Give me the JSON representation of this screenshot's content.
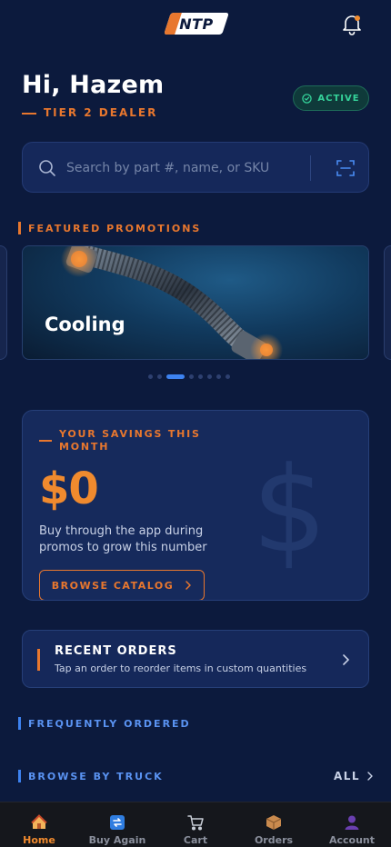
{
  "header": {
    "logo_text": "NTP",
    "has_notification": true
  },
  "greeting": {
    "title": "Hi, Hazem",
    "tier": "TIER 2 DEALER",
    "status_badge": "ACTIVE"
  },
  "search": {
    "placeholder": "Search by part #, name, or SKU",
    "value": ""
  },
  "promotions": {
    "section_title": "FEATURED PROMOTIONS",
    "current_title": "Cooling",
    "slide_count": 9,
    "active_index": 2
  },
  "savings": {
    "kicker": "YOUR SAVINGS THIS MONTH",
    "amount": "$0",
    "description": "Buy through the app during promos to grow this number",
    "cta": "BROWSE CATALOG"
  },
  "recent_orders": {
    "title": "RECENT ORDERS",
    "subtitle": "Tap an order to reorder items in custom quantities"
  },
  "frequently_ordered": {
    "title": "FREQUENTLY ORDERED"
  },
  "browse_by_truck": {
    "title": "BROWSE BY TRUCK",
    "action": "ALL"
  },
  "nav": {
    "items": [
      {
        "label": "Home",
        "icon": "home-icon",
        "active": true
      },
      {
        "label": "Buy Again",
        "icon": "repeat-icon",
        "active": false
      },
      {
        "label": "Cart",
        "icon": "cart-icon",
        "active": false
      },
      {
        "label": "Orders",
        "icon": "package-icon",
        "active": false
      },
      {
        "label": "Account",
        "icon": "person-icon",
        "active": false
      }
    ]
  },
  "colors": {
    "background": "#0c1a3d",
    "accent_orange": "#e8772e",
    "accent_blue": "#3d82f0",
    "active_green": "#35d39a"
  }
}
